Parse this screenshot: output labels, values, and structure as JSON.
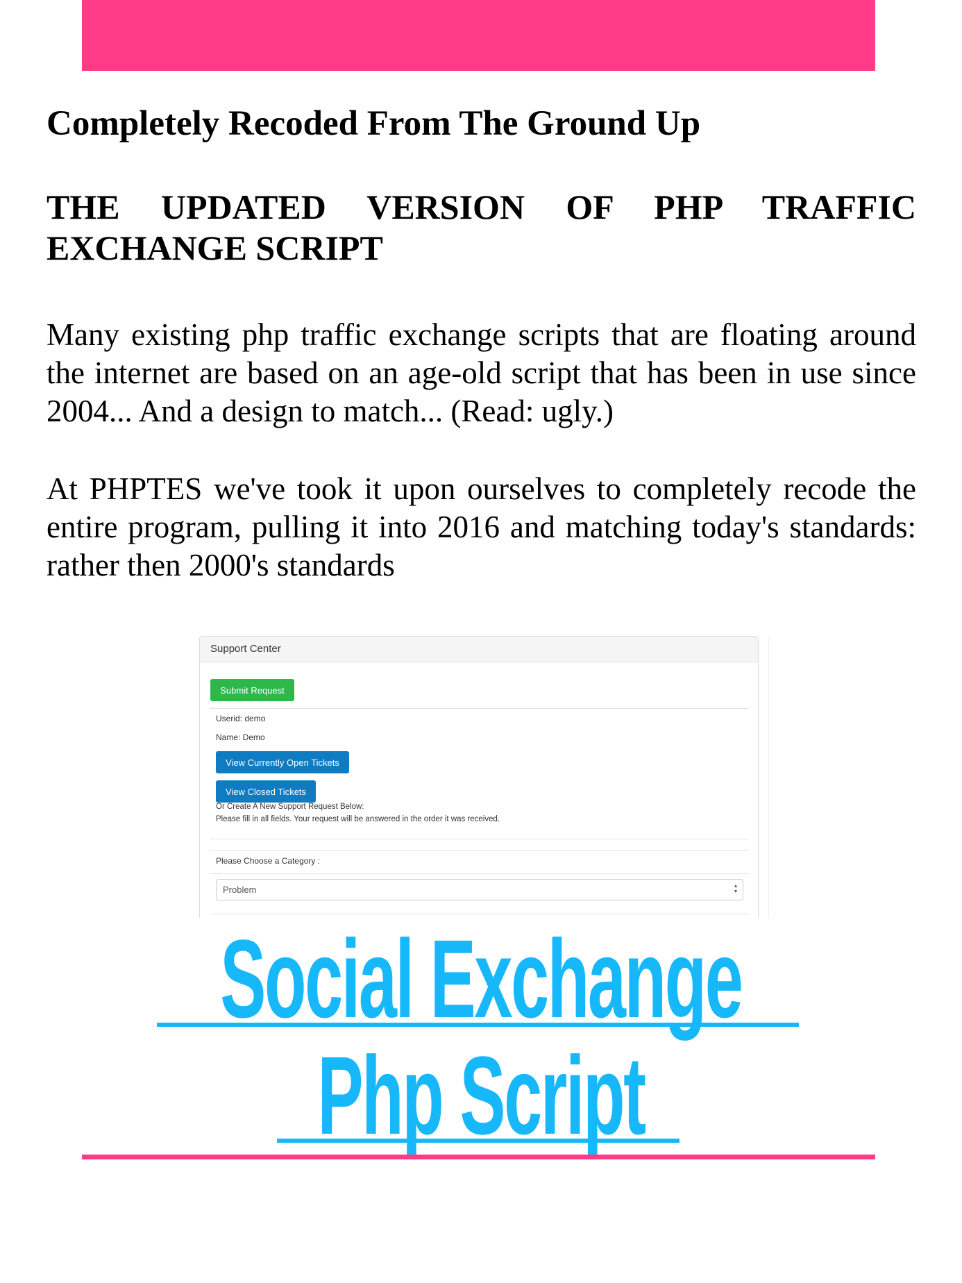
{
  "colors": {
    "accent_pink": "#ff3a87",
    "title_blue": "#17b8fa",
    "button_green": "#2cb84b",
    "button_blue": "#0f7bc0"
  },
  "document": {
    "heading": "Completely Recoded From The Ground Up",
    "subheading_line1": "THE UPDATED VERSION OF PHP TRAFFIC",
    "subheading_line2": "EXCHANGE SCRIPT",
    "paragraph1": [
      "Many existing php traffic exchange scripts that are floating around",
      "the internet are based on an age-old script that has been in use since",
      "2004... And a design to match... (Read: ugly.)"
    ],
    "paragraph2": [
      "At PHPTES we've took it upon ourselves to completely recode the",
      "entire program, pulling it into 2016 and matching today's standards:",
      "rather then 2000's standards"
    ],
    "title_line1": "Social Exchange",
    "title_line2": "Php Script"
  },
  "screenshot": {
    "panel_title": "Support Center",
    "submit_button": "Submit Request",
    "userid": "Userid: demo",
    "name": "Name: Demo",
    "open_tickets_button": "View Currently Open Tickets",
    "closed_tickets_button": "View Closed Tickets",
    "create_prompt": "Or Create A New Support Request Below:",
    "instructions": "Please fill in all fields. Your request will be answered in the order it was received.",
    "category_label": "Please Choose a Category :",
    "category_selected": "Problem",
    "select_arrows_icon": "▲▼"
  }
}
